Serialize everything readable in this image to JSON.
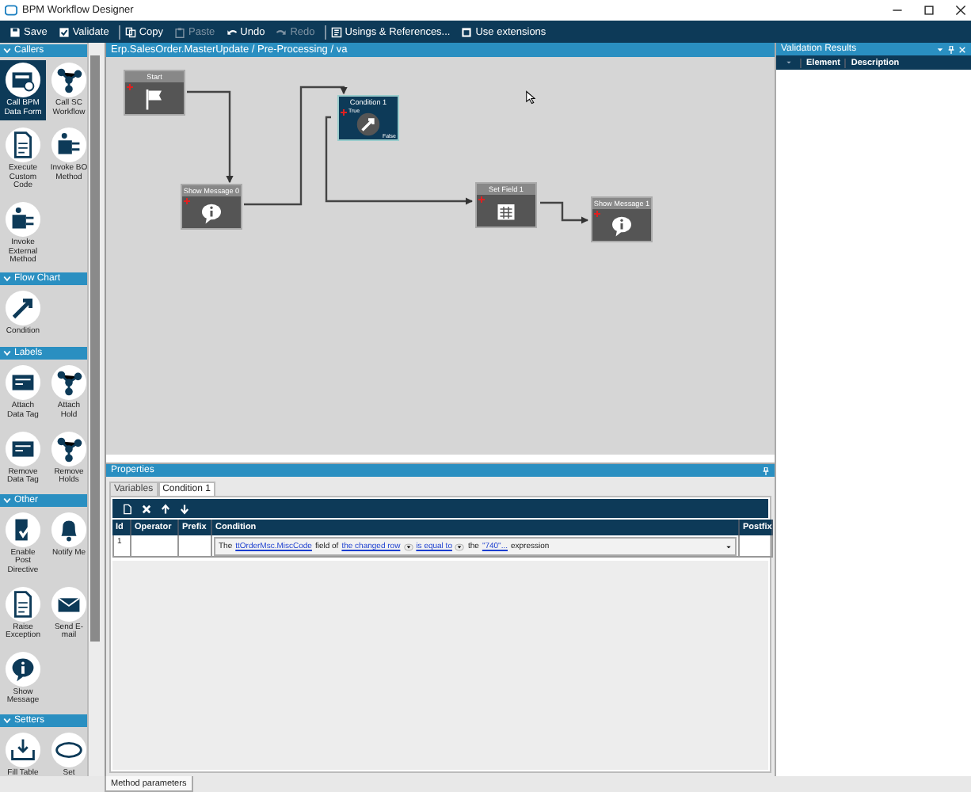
{
  "window": {
    "title": "BPM Workflow Designer"
  },
  "toolbar": [
    {
      "label": "Save",
      "disabled": false
    },
    {
      "label": "Validate",
      "disabled": false
    },
    {
      "label": "Copy",
      "disabled": false
    },
    {
      "label": "Paste",
      "disabled": true
    },
    {
      "label": "Undo",
      "disabled": false
    },
    {
      "label": "Redo",
      "disabled": true
    },
    {
      "label": "Usings & References...",
      "disabled": false
    },
    {
      "label": "Use extensions",
      "disabled": false
    }
  ],
  "palette": [
    {
      "title": "Callers",
      "items": [
        {
          "label": "Call BPM Data Form",
          "selected": true
        },
        {
          "label": "Call SC Workflow",
          "selected": false
        },
        {
          "label": "Execute Custom Code",
          "selected": false
        },
        {
          "label": "Invoke BO Method",
          "selected": false
        },
        {
          "label": "Invoke External Method",
          "selected": false
        }
      ]
    },
    {
      "title": "Flow Chart",
      "items": [
        {
          "label": "Condition",
          "selected": false
        }
      ]
    },
    {
      "title": "Labels",
      "items": [
        {
          "label": "Attach Data Tag",
          "selected": false
        },
        {
          "label": "Attach Hold",
          "selected": false
        },
        {
          "label": "Remove Data Tag",
          "selected": false
        },
        {
          "label": "Remove Holds",
          "selected": false
        }
      ]
    },
    {
      "title": "Other",
      "items": [
        {
          "label": "Enable Post Directive",
          "selected": false
        },
        {
          "label": "Notify Me",
          "selected": false
        },
        {
          "label": "Raise Exception",
          "selected": false
        },
        {
          "label": "Send E-mail",
          "selected": false
        },
        {
          "label": "Show Message",
          "selected": false
        }
      ]
    },
    {
      "title": "Setters",
      "items": [
        {
          "label": "Fill Table",
          "selected": false
        },
        {
          "label": "Set",
          "selected": false
        }
      ]
    }
  ],
  "canvas": {
    "breadcrumb": "Erp.SalesOrder.MasterUpdate / Pre-Processing / va",
    "nodes": [
      {
        "title": "Start",
        "kind": "start",
        "selected": false
      },
      {
        "title": "Show Message 0",
        "kind": "message",
        "selected": false
      },
      {
        "title": "Condition 1",
        "kind": "condition",
        "selected": true,
        "true_label": "True",
        "false_label": "False"
      },
      {
        "title": "Set Field 1",
        "kind": "set-field",
        "selected": false
      },
      {
        "title": "Show Message 1",
        "kind": "message",
        "selected": false
      }
    ]
  },
  "properties": {
    "title": "Properties",
    "tabs": [
      {
        "label": "Variables",
        "selected": false
      },
      {
        "label": "Condition 1",
        "selected": true
      }
    ],
    "columns": [
      "Id",
      "Operator",
      "Prefix",
      "Condition",
      "Postfix"
    ],
    "rows": [
      {
        "id": "1",
        "operator": "",
        "prefix": "",
        "postfix": "",
        "condition": [
          {
            "kind": "text",
            "text": "The"
          },
          {
            "kind": "link",
            "text": "ttOrderMsc.MiscCode"
          },
          {
            "kind": "text",
            "text": "field of"
          },
          {
            "kind": "menu-link",
            "text": "the changed row"
          },
          {
            "kind": "menu-link",
            "text": "is equal to"
          },
          {
            "kind": "text",
            "text": "the"
          },
          {
            "kind": "link",
            "text": "\"740\"..."
          },
          {
            "kind": "text",
            "text": "expression"
          }
        ]
      }
    ]
  },
  "validation": {
    "title": "Validation Results",
    "columns": [
      "Element",
      "Description"
    ]
  },
  "bottom_tabs": [
    {
      "label": "Method parameters",
      "selected": true
    }
  ]
}
